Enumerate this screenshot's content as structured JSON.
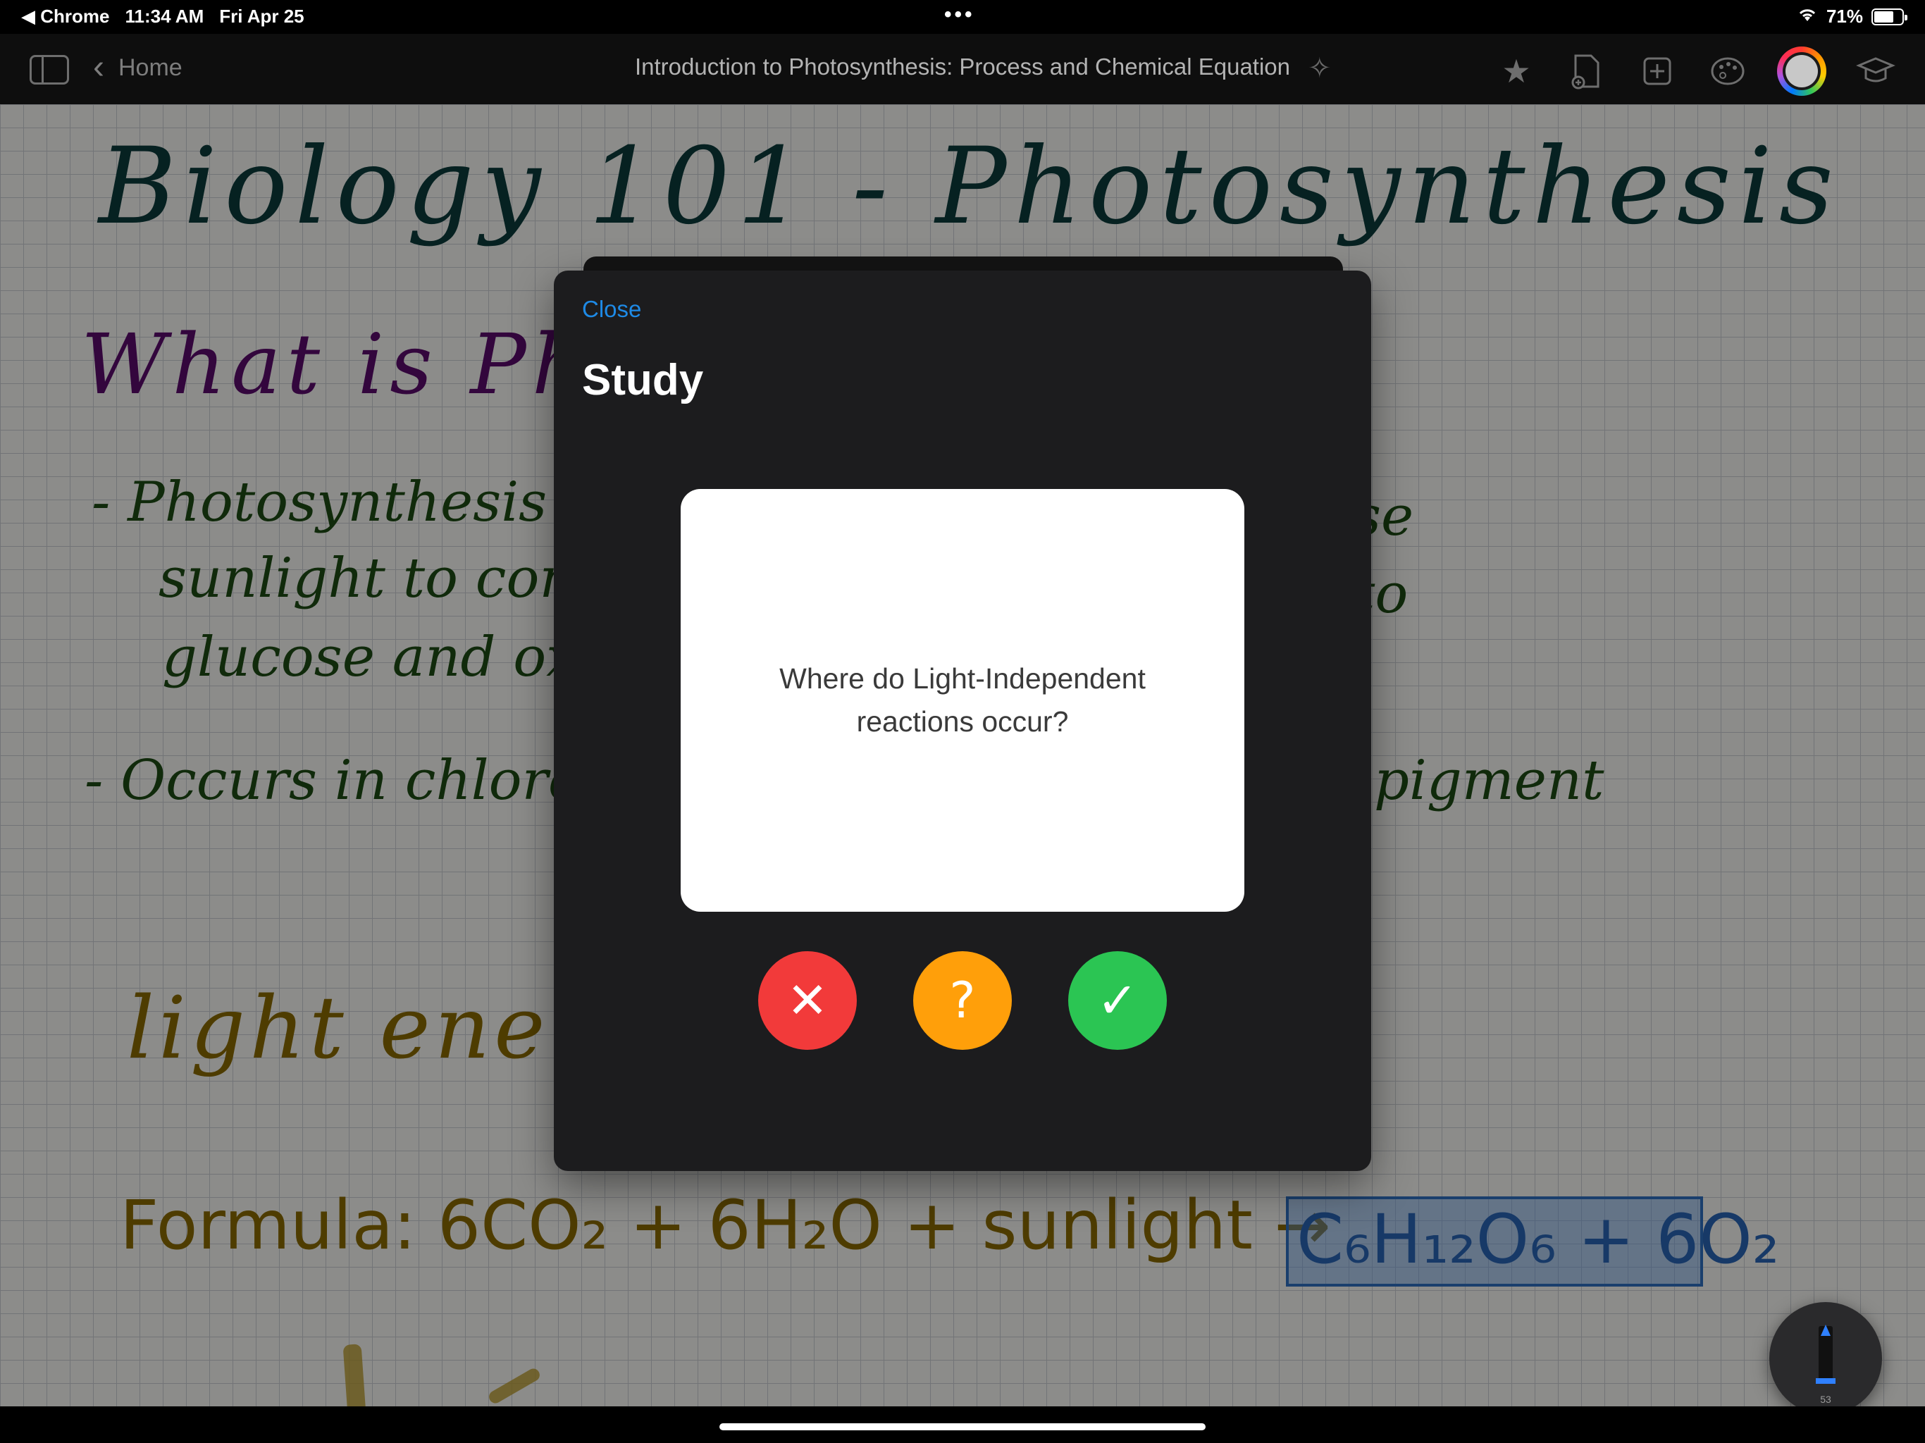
{
  "status_bar": {
    "back_app": "◀ Chrome",
    "time": "11:34 AM",
    "date": "Fri Apr 25",
    "battery_percent": "71%",
    "battery_level": 0.71
  },
  "nav": {
    "back_label": "Home",
    "document_title": "Introduction to Photosynthesis: Process and Chemical Equation",
    "tool_icons": [
      "sidebar-icon",
      "magic-wand-icon",
      "star-icon",
      "add-page-icon",
      "add-box-icon",
      "palette-icon",
      "color-picker-icon",
      "study-cap-icon"
    ]
  },
  "notes": {
    "title": "Biology 101 - Photosynthesis",
    "heading": "What is Pho",
    "line1_left": "- Photosynthesis is",
    "line1_right": "se",
    "line2_left": "sunlight to con",
    "line2_right": "to",
    "line3_left": "glucose and oxy",
    "line4_left": "- Occurs in chloro",
    "line4_right": "pigment",
    "light_energy": "light energy",
    "formula": "Formula: 6CO₂ + 6H₂O + sunlight →",
    "formula_product": "C₆H₁₂O₆ + 6O₂"
  },
  "modal": {
    "close_label": "Close",
    "title": "Study",
    "question": "Where do Light-Independent reactions occur?",
    "buttons": {
      "wrong": "✕",
      "unsure": "?",
      "right": "✓"
    }
  },
  "pencil": {
    "size_label": "53"
  },
  "colors": {
    "close_link": "#1e8ae6",
    "wrong": "#f23a3a",
    "unsure": "#ff9f0a",
    "right": "#2bc553",
    "modal_bg": "#1c1c1e"
  }
}
